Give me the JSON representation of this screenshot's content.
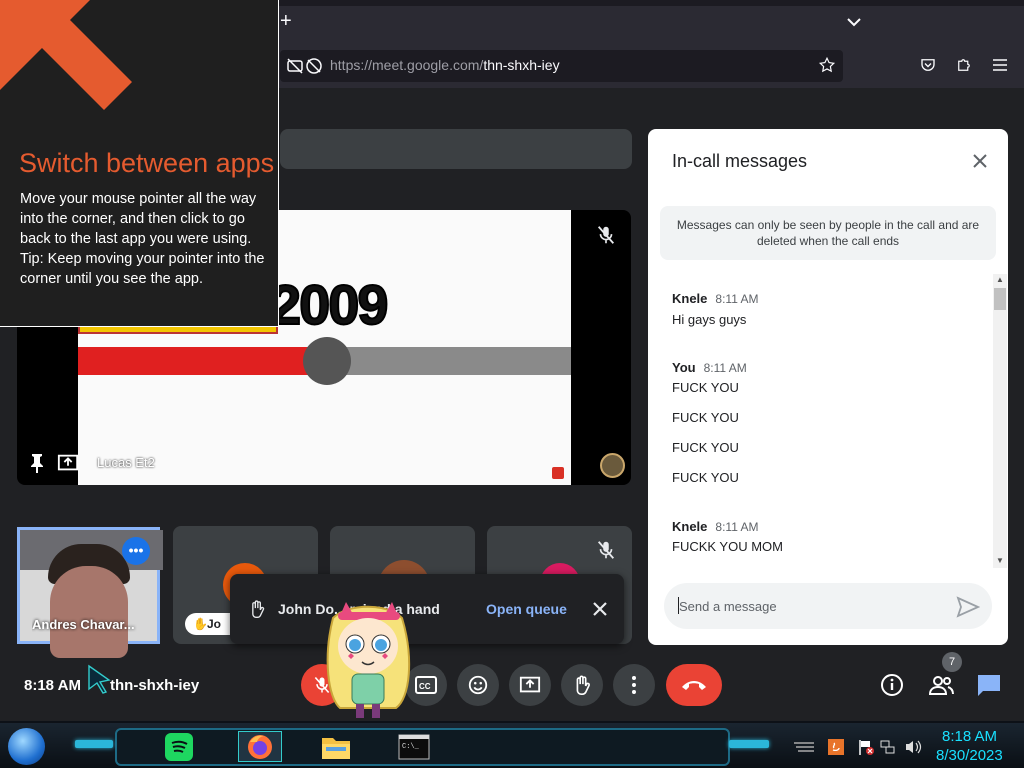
{
  "browser": {
    "new_tab_glyph": "+",
    "url_host": "https://meet.google.com/",
    "url_path": "thn-shxh-iey"
  },
  "overlay": {
    "title": "Switch between apps",
    "body": "Move your mouse pointer all the way into the corner, and then click to go back to the last app you were using.",
    "tip": "Tip: Keep moving your pointer into the corner until you see the app.",
    "arrow_color": "#e55b2f"
  },
  "main_video": {
    "tile_name": "Lucas Et2",
    "year_text": "2009",
    "progress": 0.5
  },
  "tiles": [
    {
      "name": "Andres Chavar..."
    },
    {
      "name_short": "Jo"
    },
    {},
    {}
  ],
  "toast": {
    "text": "John Do... raised a hand",
    "action": "Open queue"
  },
  "panel": {
    "title": "In-call messages",
    "notice": "Messages can only be seen by people in the call and are deleted when the call ends",
    "messages": [
      {
        "sender": "Knele",
        "time": "8:11 AM",
        "lines": [
          "Hi gays guys"
        ]
      },
      {
        "sender": "You",
        "time": "8:11 AM",
        "lines": [
          "FUCK YOU",
          "FUCK YOU",
          "FUCK YOU",
          "FUCK YOU"
        ]
      },
      {
        "sender": "Knele",
        "time": "8:11 AM",
        "lines": [
          "FUCKK YOU MOM"
        ]
      }
    ],
    "input_placeholder": "Send a message"
  },
  "controls": {
    "clock": "8:18 AM",
    "meeting_code": "thn-shxh-iey",
    "participants_count": "7"
  },
  "taskbar": {
    "time": "8:18 AM",
    "date": "8/30/2023"
  },
  "colors": {
    "accent_blue": "#8ab4f8",
    "meet_red": "#ea4335",
    "tray_cyan": "#19e0ff"
  }
}
